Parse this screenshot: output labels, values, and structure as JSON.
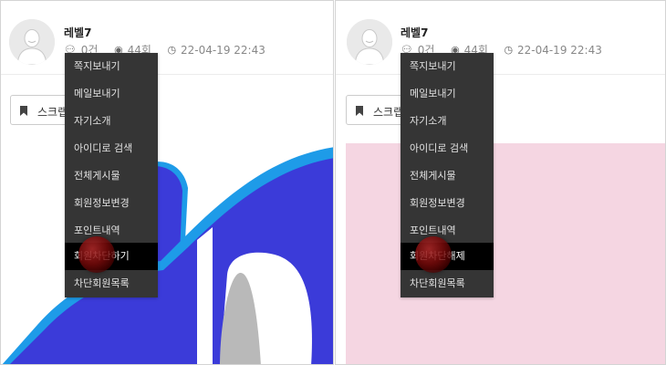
{
  "left": {
    "author": {
      "nickname": "레벨7"
    },
    "meta": {
      "comments": "0건",
      "views": "44회",
      "datetime": "22-04-19 22:43"
    },
    "scrap_label": "스크랩",
    "menu": [
      "쪽지보내기",
      "메일보내기",
      "자기소개",
      "아이디로 검색",
      "전체게시물",
      "회원정보변경",
      "포인트내역",
      "회원차단하기",
      "차단회원목록"
    ],
    "active_item": "회원차단하기"
  },
  "right": {
    "author": {
      "nickname": "레벨7"
    },
    "meta": {
      "comments": "0건",
      "views": "44회",
      "datetime": "22-04-19 22:43"
    },
    "scrap_label": "스크랩",
    "menu": [
      "쪽지보내기",
      "메일보내기",
      "자기소개",
      "아이디로 검색",
      "전체게시물",
      "회원정보변경",
      "포인트내역",
      "회원차단해제",
      "차단회원목록"
    ],
    "active_item": "회원차단해제"
  },
  "icons": {
    "comment": "comment-icon",
    "views": "eye-icon",
    "time": "clock-icon",
    "bookmark": "bookmark-icon"
  },
  "colors": {
    "menu_bg": "#353535",
    "menu_active_bg": "#000000",
    "menu_text": "#e0e0e0",
    "pink_area": "#f5d6e2",
    "art_blue": "#3b3bd9",
    "art_light_blue": "#1e9be8"
  }
}
